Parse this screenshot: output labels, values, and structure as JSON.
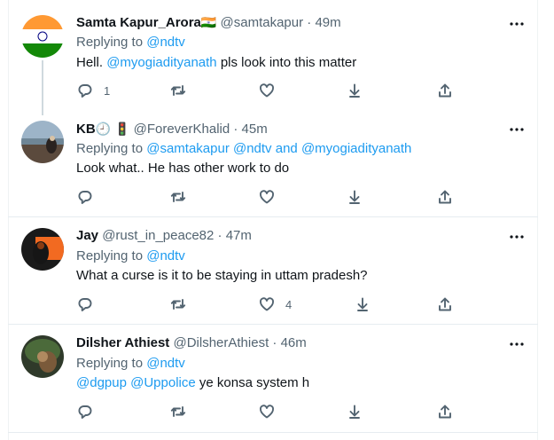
{
  "tweets": [
    {
      "name": "Samta Kapur_Arora",
      "name_emoji": "🇮🇳",
      "handle": "@samtakapur",
      "time": "· 49m",
      "replying_prefix": "Replying to ",
      "replying_to": "@ndtv",
      "body_mention": "@myogiadityanath",
      "body_pre": "Hell. ",
      "body_post": " pls look into this matter",
      "reply_count": "1",
      "like_count": ""
    },
    {
      "name": "KB",
      "name_emoji": "🕘 🚦",
      "handle": "@ForeverKhalid",
      "time": "· 45m",
      "replying_prefix": "Replying to ",
      "replying_to": "@samtakapur @ndtv",
      "replying_and": " and ",
      "replying_to_2": "@myogiadityanath",
      "body": "Look what.. He has other work to do"
    },
    {
      "name": "Jay",
      "handle": "@rust_in_peace82",
      "time": "· 47m",
      "replying_prefix": "Replying to ",
      "replying_to": "@ndtv",
      "body": "What a curse is it to be staying in uttam pradesh?",
      "like_count": "4"
    },
    {
      "name": "Dilsher Athiest",
      "handle": "@DilsherAthiest",
      "time": "· 46m",
      "replying_prefix": "Replying to ",
      "replying_to": "@ndtv",
      "body_mentions": "@dgpup @Uppolice",
      "body_post": " ye konsa system h"
    }
  ],
  "icons": [
    "reply-icon",
    "retweet-icon",
    "like-icon",
    "bookmark-icon",
    "share-icon",
    "more-icon"
  ],
  "colors": {
    "link": "#1d9bf0",
    "muted": "#536471",
    "text": "#0f1419"
  }
}
